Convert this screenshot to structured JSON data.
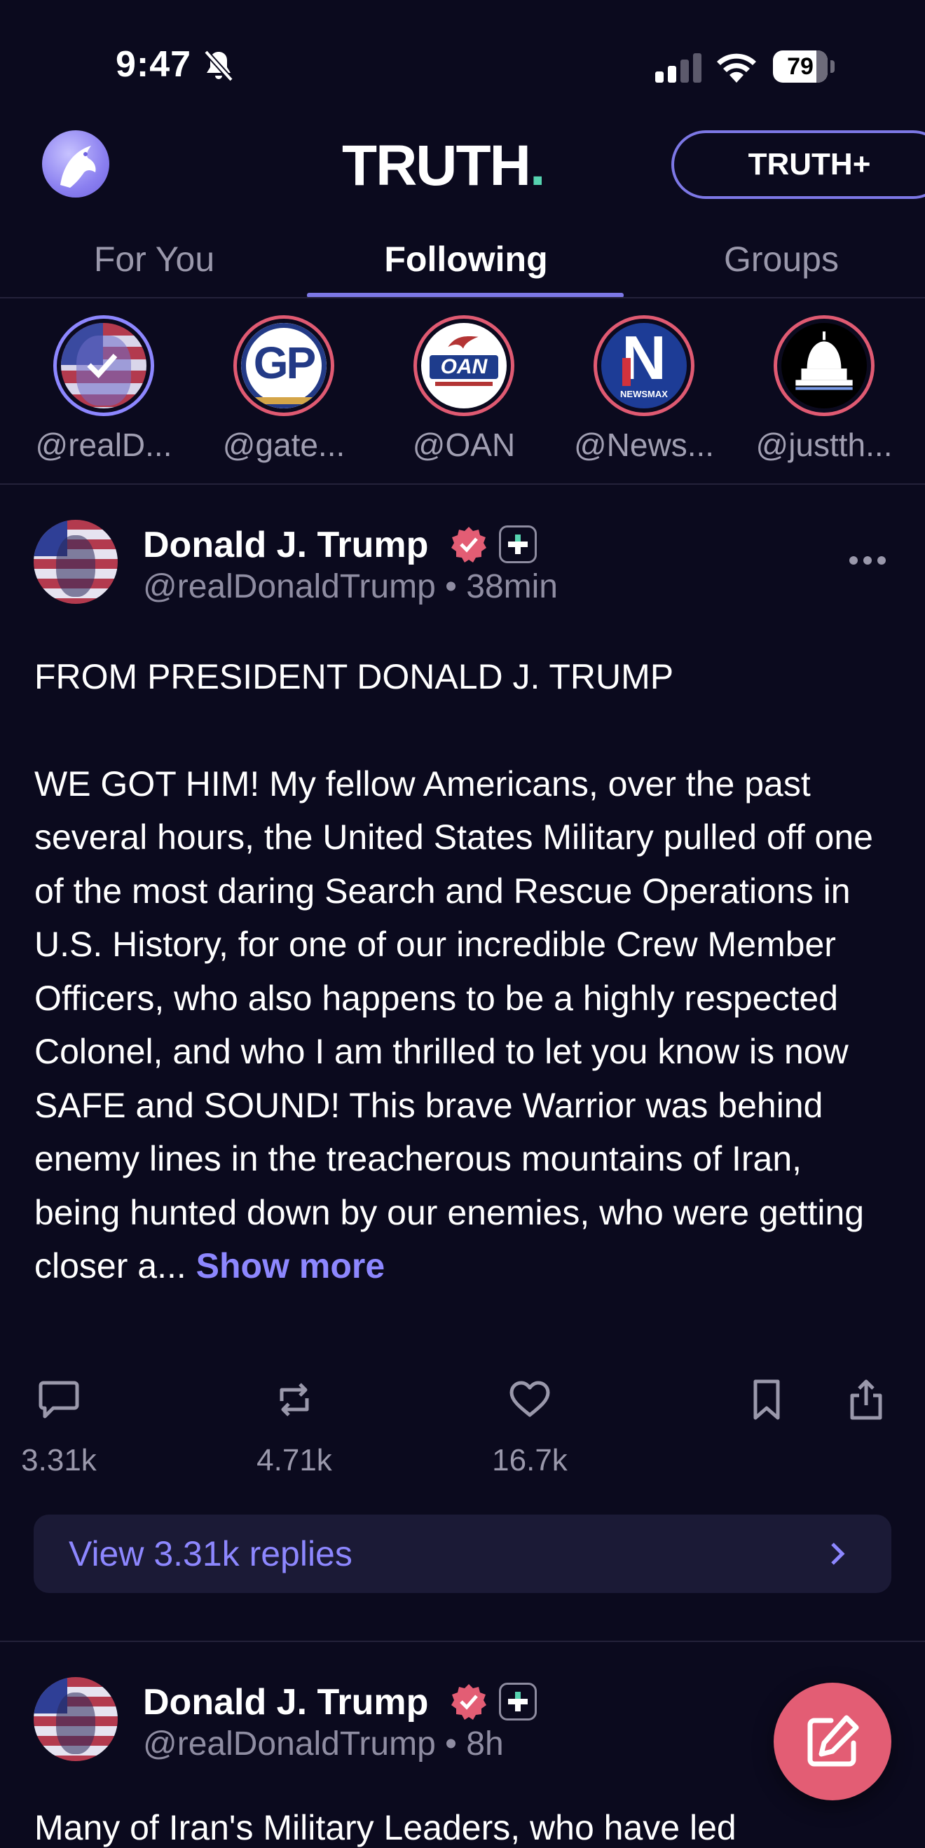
{
  "status_bar": {
    "time": "9:47",
    "battery": "79",
    "battery_level": 0.79
  },
  "header": {
    "logo": "TRUTH",
    "logo_dot": ".",
    "plus_button": "TRUTH+"
  },
  "tabs": [
    {
      "label": "For You",
      "active": false
    },
    {
      "label": "Following",
      "active": true
    },
    {
      "label": "Groups",
      "active": false
    }
  ],
  "stories": [
    {
      "label": "@realD..."
    },
    {
      "label": "@gate...",
      "logo_text": "GP"
    },
    {
      "label": "@OAN",
      "logo_text": "OAN"
    },
    {
      "label": "@News...",
      "logo_text": "N",
      "logo_subtext": "NEWSMAX"
    },
    {
      "label": "@justth..."
    }
  ],
  "posts": [
    {
      "name": "Donald J. Trump",
      "handle": "@realDonaldTrump",
      "time": "• 38min",
      "body_line1": "FROM PRESIDENT DONALD J. TRUMP",
      "body_main": "WE GOT HIM! My fellow Americans, over the past several hours, the United States Military pulled off one of the most daring Search and Rescue Operations in U.S. History, for one of our incredible Crew Member Officers, who also happens to be a highly respected Colonel, and who I am thrilled to let you know is now SAFE and SOUND! This brave Warrior was behind enemy lines in the treacherous mountains of Iran, being hunted down by our enemies, who were getting closer a...",
      "show_more": "Show more",
      "replies": "3.31k",
      "retruths": "4.71k",
      "likes": "16.7k",
      "view_replies": "View 3.31k replies"
    },
    {
      "name": "Donald J. Trump",
      "handle": "@realDonaldTrump",
      "time": "• 8h",
      "body_partial": "Many of Iran's Military Leaders, who have led"
    }
  ],
  "colors": {
    "accent": "#8d87ff",
    "brand_teal": "#57d3b0",
    "story_ring": "#e05a72",
    "compose": "#e35d74",
    "background": "#0b0a1e"
  }
}
